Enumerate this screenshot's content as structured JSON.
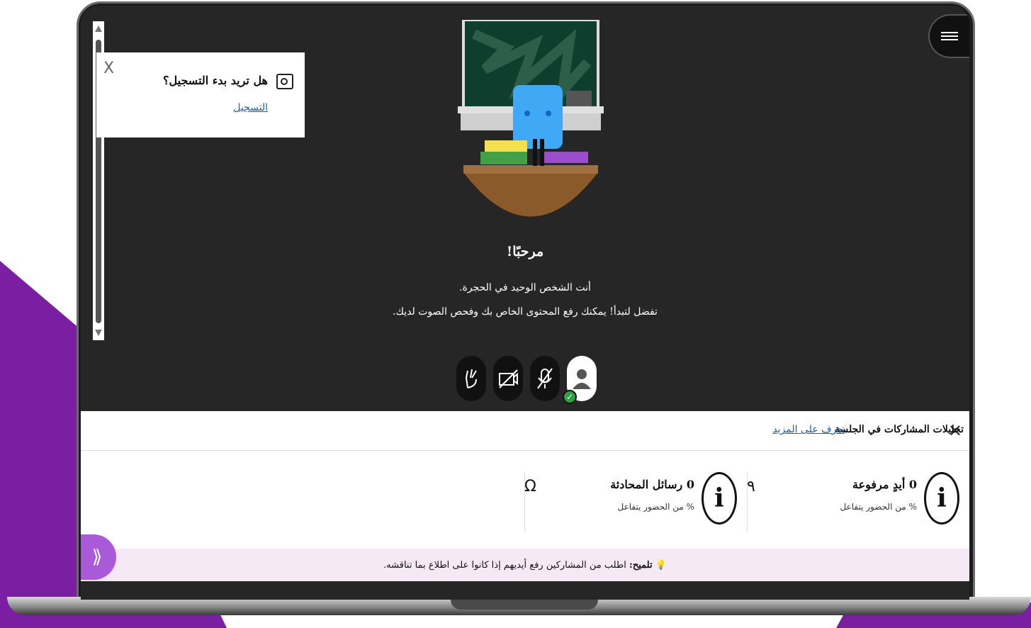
{
  "recording_prompt": {
    "question": "هل تريد بدء التسجيل؟",
    "action_link": "التسجيل",
    "close": "X"
  },
  "welcome": {
    "title": "مرحبًا!",
    "line1": "أنت الشخص الوحيد في الحجرة.",
    "line2": "تفضل لتبدأ! يمكنك رفع المحتوى الخاص بك وفحص الصوت لديك."
  },
  "controls": [
    "avatar-icon",
    "microphone-muted-icon",
    "camera-off-icon",
    "raise-hand-icon"
  ],
  "analytics": {
    "title": "تحليلات المشاركات في الجلسة",
    "learn_more": "تعرف على المزيد",
    "raised_hands": {
      "label": "0 أيدٍ مرفوعة",
      "sub": "% من الحضور يتفاعل",
      "value_text": "٩"
    },
    "chat_messages": {
      "label": "0 رسائل المحادثة",
      "sub": "% من الحضور يتفاعل",
      "value_text": "Ω"
    },
    "tip_prefix": "تلميح:",
    "tip_text": "اطلب من المشاركين رفع أيديهم إذا كانوا على اطلاع بما تناقشه.",
    "expand": "⟫"
  },
  "colors": {
    "accent": "#7b1fa2",
    "session_bg": "#262626",
    "tip_bg": "#f6e9f6",
    "expand_btn": "#a95ad8",
    "link": "#1a5fb4"
  }
}
